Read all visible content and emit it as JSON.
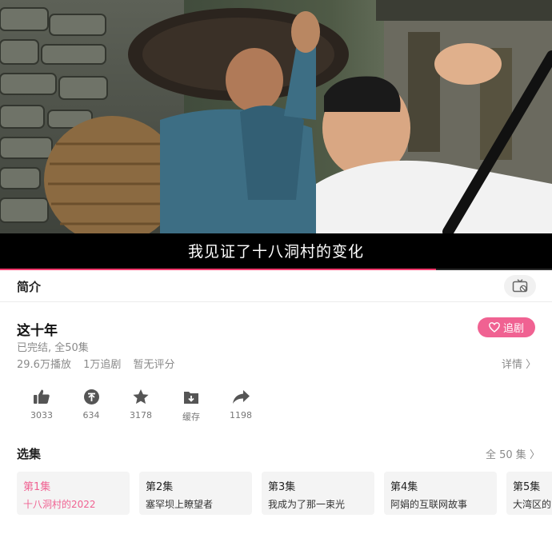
{
  "video": {
    "subtitle": "我见证了十八洞村的变化",
    "progress_fraction": 0.79
  },
  "intro": {
    "label": "简介",
    "tv_icon": "tv-off-icon"
  },
  "show": {
    "title": "这十年",
    "status": "已完结, 全50集",
    "plays": "29.6万播放",
    "follows": "1万追剧",
    "rating": "暂无评分",
    "follow_button": "追剧",
    "details_link": "详情 〉"
  },
  "actions": [
    {
      "icon": "thumbs-up-icon",
      "label": "3033"
    },
    {
      "icon": "coin-icon",
      "label": "634"
    },
    {
      "icon": "star-icon",
      "label": "3178"
    },
    {
      "icon": "download-icon",
      "label": "缓存"
    },
    {
      "icon": "share-icon",
      "label": "1198"
    }
  ],
  "episodes": {
    "header": "选集",
    "all_label": "全 50 集 〉",
    "items": [
      {
        "num": "第1集",
        "name": "十八洞村的2022",
        "active": true
      },
      {
        "num": "第2集",
        "name": "塞罕坝上瞭望者",
        "active": false
      },
      {
        "num": "第3集",
        "name": "我成为了那一束光",
        "active": false
      },
      {
        "num": "第4集",
        "name": "阿娟的互联网故事",
        "active": false
      },
      {
        "num": "第5集",
        "name": "大湾区的",
        "active": false
      }
    ]
  },
  "colors": {
    "accent": "#f06292",
    "progress": "#ff3b6f"
  }
}
